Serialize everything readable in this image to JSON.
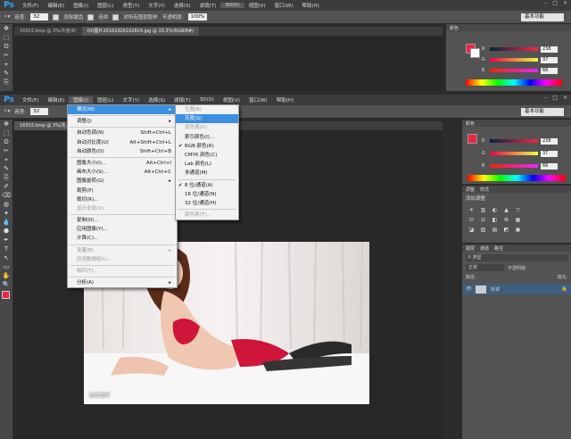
{
  "app": {
    "logo": "Ps",
    "menu": [
      "文件(F)",
      "编辑(E)",
      "图像(I)",
      "图层(L)",
      "类型(Y)",
      "文字(Y)",
      "选择(S)",
      "滤镜(T)",
      "3D(D)",
      "视图(V)",
      "窗口(W)",
      "帮助(H)"
    ],
    "menu_lower": [
      "文件(F)",
      "编辑(E)",
      "图像(I)",
      "图层(L)",
      "文字(Y)",
      "选择(S)",
      "滤镜(T)",
      "3D(D)",
      "视图(V)",
      "窗口(W)",
      "帮助(H)"
    ],
    "window_controls": [
      "–",
      "□",
      "×"
    ]
  },
  "options_top": {
    "tolerance_label": "容差:",
    "tolerance_value": "32",
    "anti_alias": "消除锯齿",
    "contiguous": "连续",
    "sample_all": "对所有图层取样",
    "opacity_label": "不透明度:",
    "opacity_value": "100%",
    "workspace": "基本功能"
  },
  "options_lower": {
    "tolerance_label": "容差:",
    "tolerance_value": "32",
    "workspace": "基本功能"
  },
  "tabs_top": [
    "16503.bmp @ 3%(灰度/8)",
    "QQ图片20161026102824.jpg @ 33.3%(RGB/8#)"
  ],
  "tabs_lower": [
    "16503.bmp @ 3%(灰..."
  ],
  "color_panel": {
    "header": "颜色",
    "top": {
      "r": "238",
      "g": "37",
      "b": "66"
    },
    "lower": {
      "r": "238",
      "g": "37",
      "b": "66"
    },
    "labels": [
      "R",
      "G",
      "B"
    ],
    "fg_color": "#ee2542",
    "bg_color": "#ffffff"
  },
  "adjust_panel": {
    "tabs": [
      "调整",
      "样式"
    ],
    "title": "添加调整",
    "icons": [
      "☀",
      "▥",
      "◐",
      "▲",
      "▽",
      "⊡",
      "⚖",
      "◧",
      "♻",
      "▦",
      "◪",
      "▨",
      "▤",
      "◩",
      "▣"
    ]
  },
  "layers_panel": {
    "tabs": [
      "图层",
      "通道",
      "路径"
    ],
    "kind": "P 类型",
    "blend": "正常",
    "opacity_label": "不透明度:",
    "lock_label": "锁定:",
    "fill_label": "填充:",
    "layer_name": "背景"
  },
  "image_menu": {
    "items": [
      {
        "label": "模式(M)",
        "shortcut": "",
        "arrow": true,
        "state": "hl"
      },
      {
        "sep": true
      },
      {
        "label": "调整(J)",
        "shortcut": "",
        "arrow": true
      },
      {
        "sep": true
      },
      {
        "label": "自动色调(N)",
        "shortcut": "Shift+Ctrl+L"
      },
      {
        "label": "自动对比度(U)",
        "shortcut": "Alt+Shift+Ctrl+L"
      },
      {
        "label": "自动颜色(O)",
        "shortcut": "Shift+Ctrl+B"
      },
      {
        "sep": true
      },
      {
        "label": "图像大小(I)...",
        "shortcut": "Alt+Ctrl+I"
      },
      {
        "label": "画布大小(S)...",
        "shortcut": "Alt+Ctrl+C"
      },
      {
        "label": "图像旋转(G)",
        "shortcut": "",
        "arrow": true
      },
      {
        "label": "裁剪(P)",
        "shortcut": ""
      },
      {
        "label": "裁切(R)...",
        "shortcut": ""
      },
      {
        "label": "显示全部(V)",
        "shortcut": "",
        "state": "dis"
      },
      {
        "sep": true
      },
      {
        "label": "复制(D)...",
        "shortcut": ""
      },
      {
        "label": "应用图像(Y)...",
        "shortcut": ""
      },
      {
        "label": "计算(C)...",
        "shortcut": ""
      },
      {
        "sep": true
      },
      {
        "label": "变量(B)",
        "shortcut": "",
        "arrow": true,
        "state": "dis"
      },
      {
        "label": "应用数据组(L)...",
        "shortcut": "",
        "state": "dis"
      },
      {
        "sep": true
      },
      {
        "label": "陷印(T)...",
        "shortcut": "",
        "state": "dis"
      },
      {
        "sep": true
      },
      {
        "label": "分析(A)",
        "shortcut": "",
        "arrow": true
      }
    ]
  },
  "mode_submenu": {
    "items": [
      {
        "label": "位图(B)",
        "state": "dis"
      },
      {
        "label": "灰度(G)",
        "state": "hl"
      },
      {
        "label": "双色调(D)",
        "state": "dis"
      },
      {
        "label": "索引颜色(I)..."
      },
      {
        "label": "RGB 颜色(R)",
        "check": true
      },
      {
        "label": "CMYK 颜色(C)"
      },
      {
        "label": "Lab 颜色(L)"
      },
      {
        "label": "多通道(M)"
      },
      {
        "sep": true
      },
      {
        "label": "8 位/通道(A)",
        "check": true
      },
      {
        "label": "16 位/通道(N)"
      },
      {
        "label": "32 位/通道(H)"
      },
      {
        "sep": true
      },
      {
        "label": "颜色表(T)...",
        "state": "dis"
      }
    ]
  },
  "tools": [
    "✥",
    "⬚",
    "ʘ",
    "✂",
    "⌖",
    "✎",
    "⎘",
    "✐",
    "⌫",
    "◍",
    "✦",
    "💧",
    "⬣",
    "✒",
    "T",
    "↖",
    "▭",
    "✋",
    "🔍"
  ],
  "canvas": {
    "watermark": "美女图片"
  }
}
